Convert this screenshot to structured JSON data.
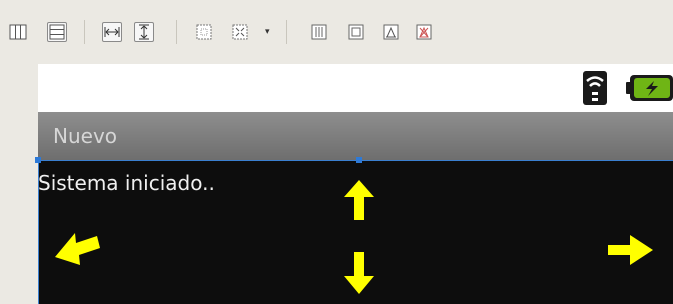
{
  "toolbar": {
    "buttons": [
      {
        "name": "layout-columns-icon"
      },
      {
        "name": "layout-rows-icon"
      },
      {
        "name": "fill-width-icon"
      },
      {
        "name": "fill-height-icon"
      },
      {
        "name": "zoom-fit-icon"
      },
      {
        "name": "zoom-actual-icon"
      },
      {
        "name": "dropdown-arrow-icon"
      },
      {
        "name": "distribute-horizontal-icon"
      },
      {
        "name": "distribute-vertical-icon"
      },
      {
        "name": "anchor-icon"
      },
      {
        "name": "anchor-remove-icon"
      }
    ],
    "dropdown_glyph": "▾"
  },
  "preview": {
    "title": "Nuevo",
    "content_text": "Sistema iniciado..",
    "status_icons": [
      "wifi-signal-icon",
      "battery-charging-icon"
    ],
    "colors": {
      "title_bar": "#7e7e7e",
      "content_bg": "#0d0d0d",
      "selection": "#2d7ad8",
      "arrows": "#ffff00",
      "battery": "#6fb515"
    }
  }
}
